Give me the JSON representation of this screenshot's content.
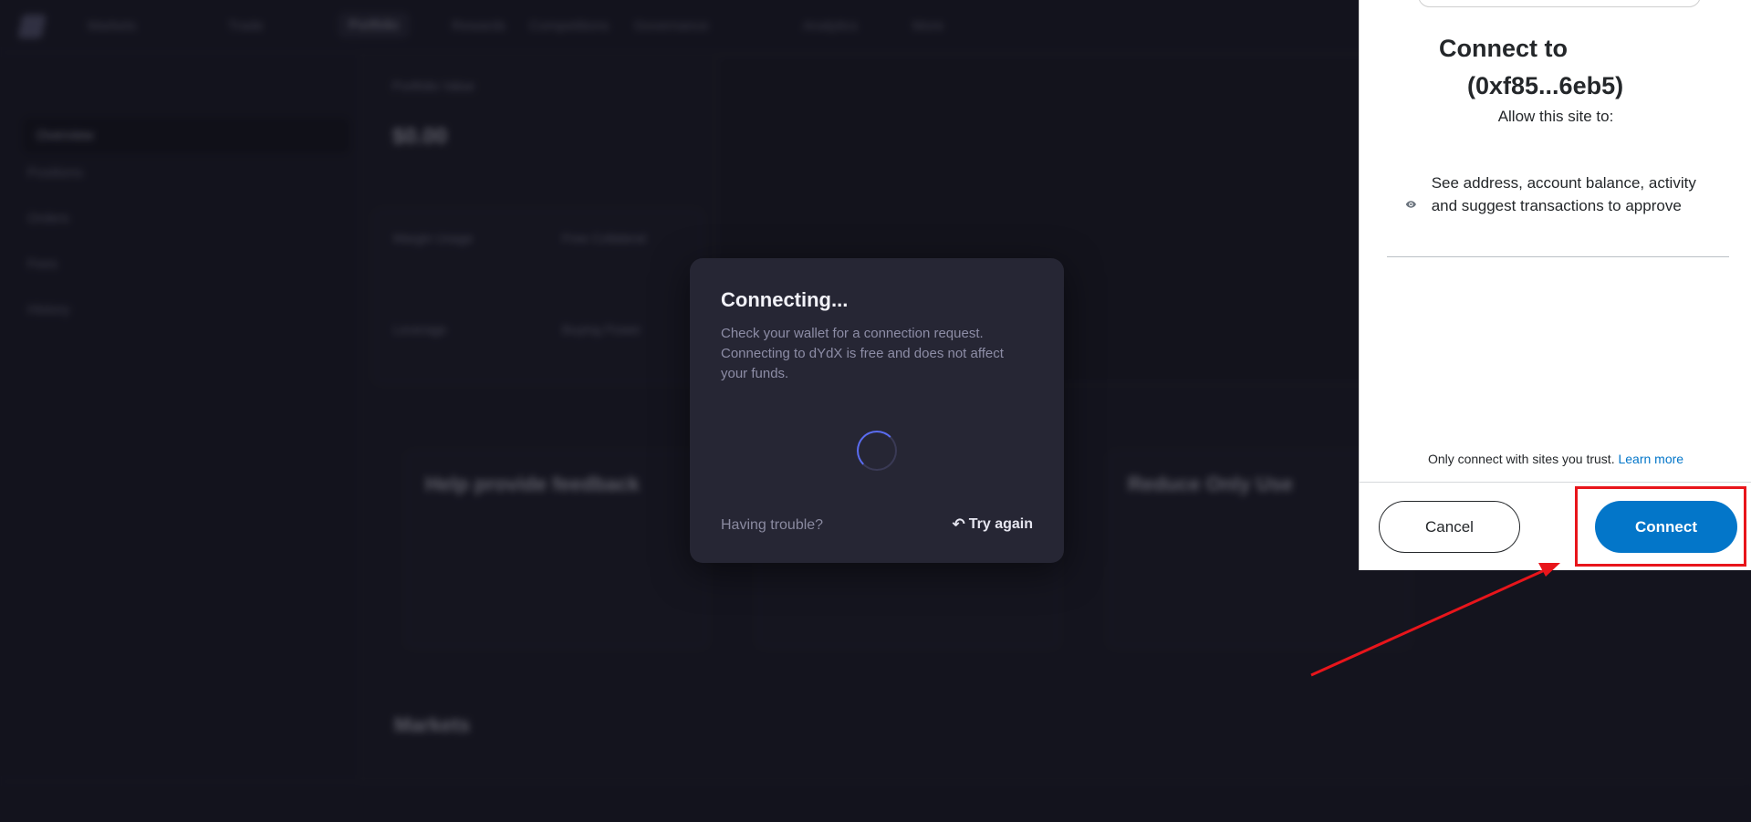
{
  "background_app": {
    "nav": [
      "Markets",
      "Trade",
      "Portfolio",
      "Rewards",
      "Competitions",
      "Governance",
      "Analytics",
      "More"
    ],
    "sidebar": [
      "Overview",
      "Positions",
      "Orders",
      "Fees",
      "History"
    ],
    "portfolio_label": "Portfolio Value",
    "portfolio_value": "$0.00",
    "stats": [
      "Margin Usage",
      "Free Collateral",
      "Leverage",
      "Buying Power"
    ],
    "cards": [
      "Help provide feedback",
      "Reduce Only Use"
    ],
    "markets_title": "Markets"
  },
  "connect_modal": {
    "title": "Connecting...",
    "description": "Check your wallet for a connection request. Connecting to dYdX is free and does not affect your funds.",
    "trouble": "Having trouble?",
    "retry": "Try again",
    "retry_icon": "undo-icon"
  },
  "metamask": {
    "title_line1": "Connect to",
    "title_line2": "(0xf85...6eb5)",
    "allow": "Allow this site to:",
    "permission_icon": "eye-icon",
    "permission": "See address, account balance, activity and suggest transactions to approve",
    "trust": "Only connect with sites you trust.",
    "learn_more": "Learn more",
    "cancel": "Cancel",
    "connect": "Connect",
    "brand_color": "#0376c9"
  },
  "annotation": {
    "color": "#e8151b"
  }
}
